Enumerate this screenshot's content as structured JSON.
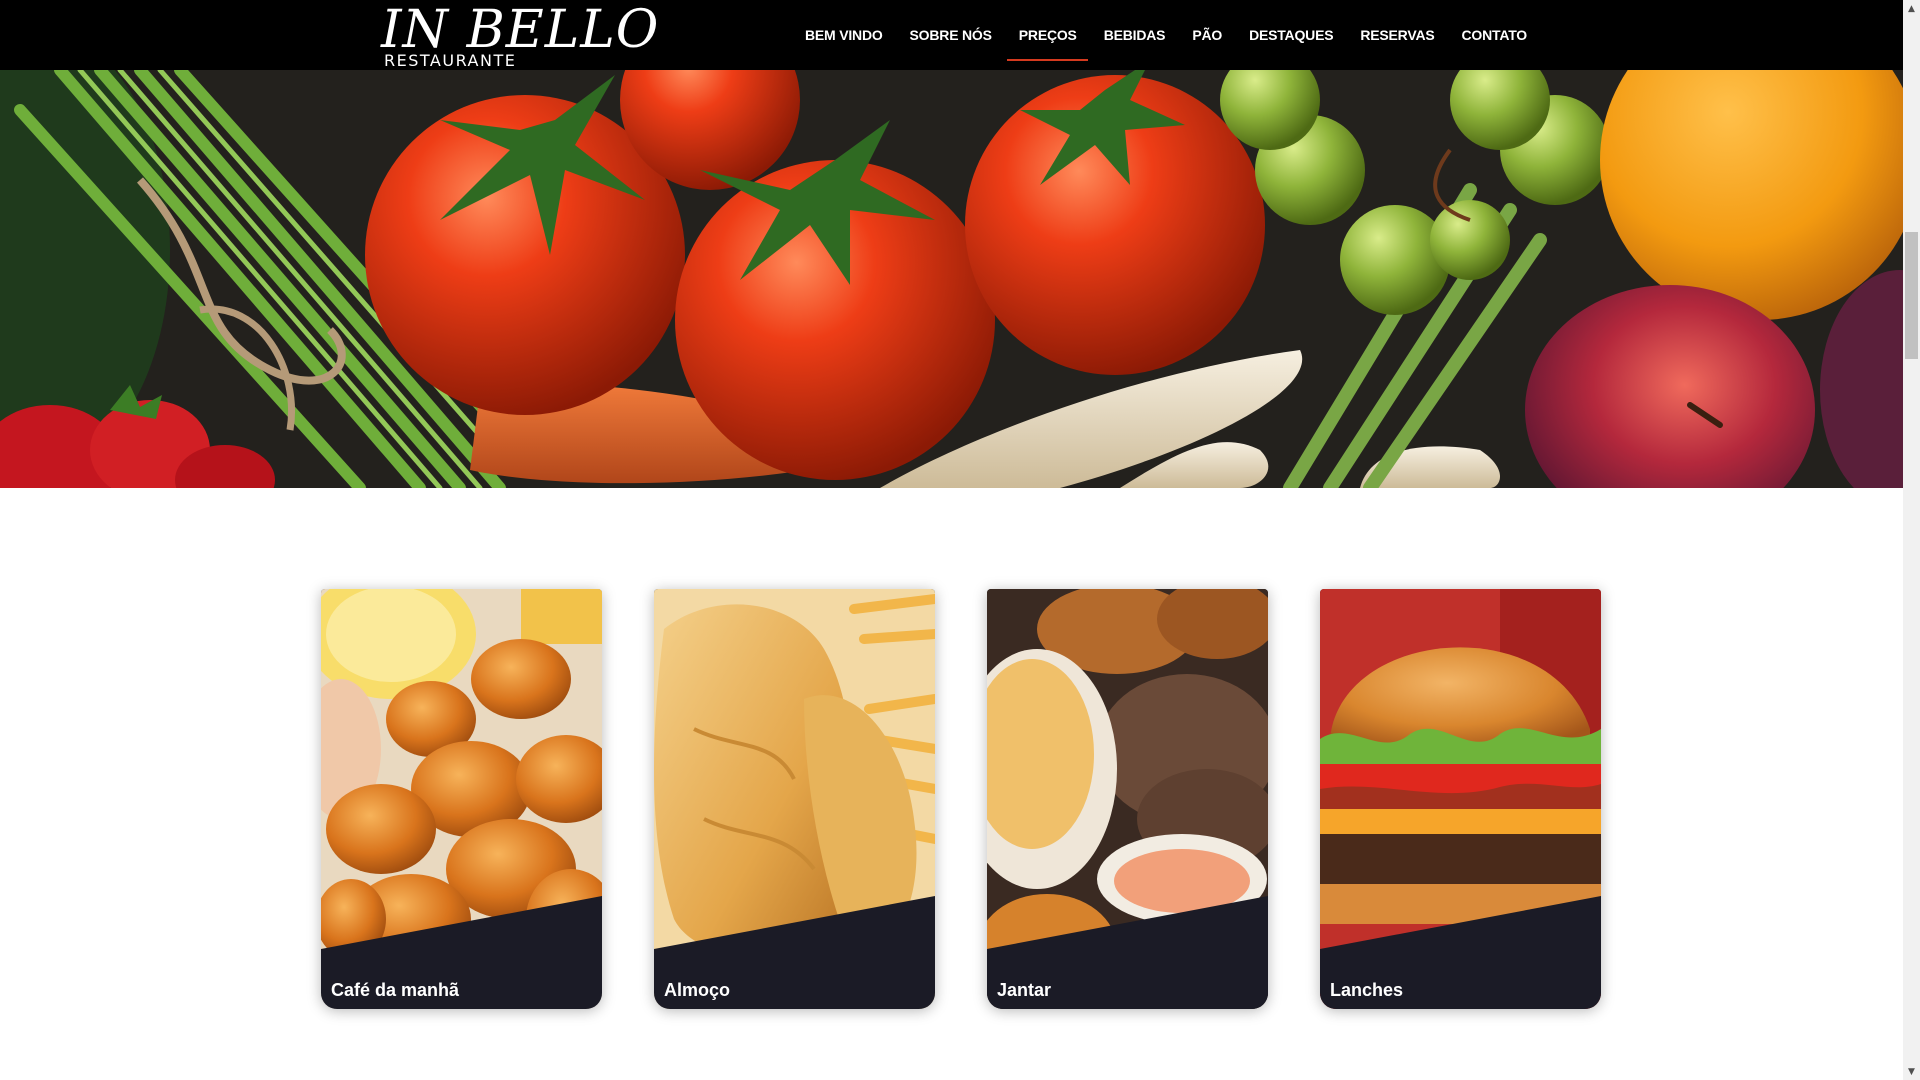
{
  "brand": {
    "name": "IN BELLO",
    "subtitle": "RESTAURANTE"
  },
  "nav": {
    "items": [
      {
        "label": "BEM VINDO"
      },
      {
        "label": "SOBRE NÓS"
      },
      {
        "label": "PREÇOS",
        "active": true
      },
      {
        "label": "BEBIDAS"
      },
      {
        "label": "PÃO"
      },
      {
        "label": "DESTAQUES"
      },
      {
        "label": "RESERVAS"
      },
      {
        "label": "CONTATO"
      }
    ],
    "active_color": "#d43a1f"
  },
  "hero": {
    "subject": "fresh vegetables and fruits"
  },
  "cards": [
    {
      "label": "Café da manhã",
      "image": "fried-shrimp"
    },
    {
      "label": "Almoço",
      "image": "fried-fish-and-chips"
    },
    {
      "label": "Jantar",
      "image": "fried-chicken-wings"
    },
    {
      "label": "Lanches",
      "image": "burger"
    }
  ],
  "colors": {
    "header_bg": "#000000",
    "card_footer_bg": "#1b1b26",
    "page_bg": "#ffffff"
  },
  "icons": {
    "scroll_up": "scroll-up-arrow-icon",
    "scroll_down": "scroll-down-arrow-icon"
  }
}
